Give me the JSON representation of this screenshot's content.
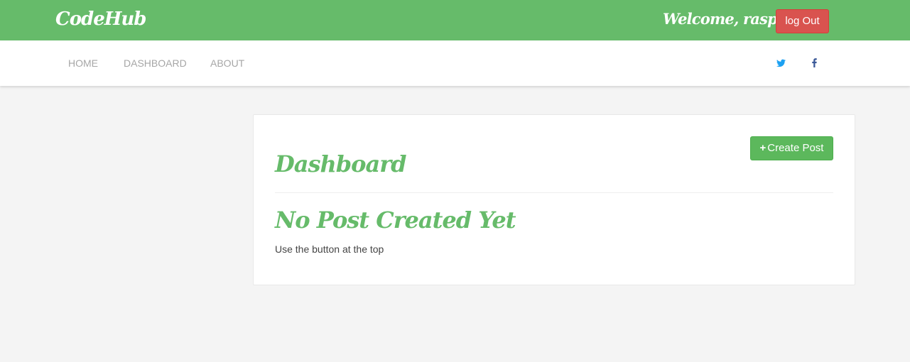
{
  "header": {
    "brand": "CodeHub",
    "welcome": "Welcome, raspi",
    "logout_label": "log Out"
  },
  "nav": {
    "links": [
      "HOME",
      "DASHBOARD",
      "ABOUT"
    ],
    "social_icons": [
      "twitter-icon",
      "facebook-icon"
    ]
  },
  "dashboard": {
    "title": "Dashboard",
    "create_label": "Create Post",
    "empty_title": "No Post Created Yet",
    "empty_text": "Use the button at the top"
  },
  "colors": {
    "header_bg": "#66bb6a",
    "logout_bg": "#d9534f",
    "create_bg": "#5cb85c",
    "heading": "#66bb6a",
    "twitter": "#1da1f2",
    "facebook": "#3b5998",
    "page_bg": "#f4f4f4"
  }
}
